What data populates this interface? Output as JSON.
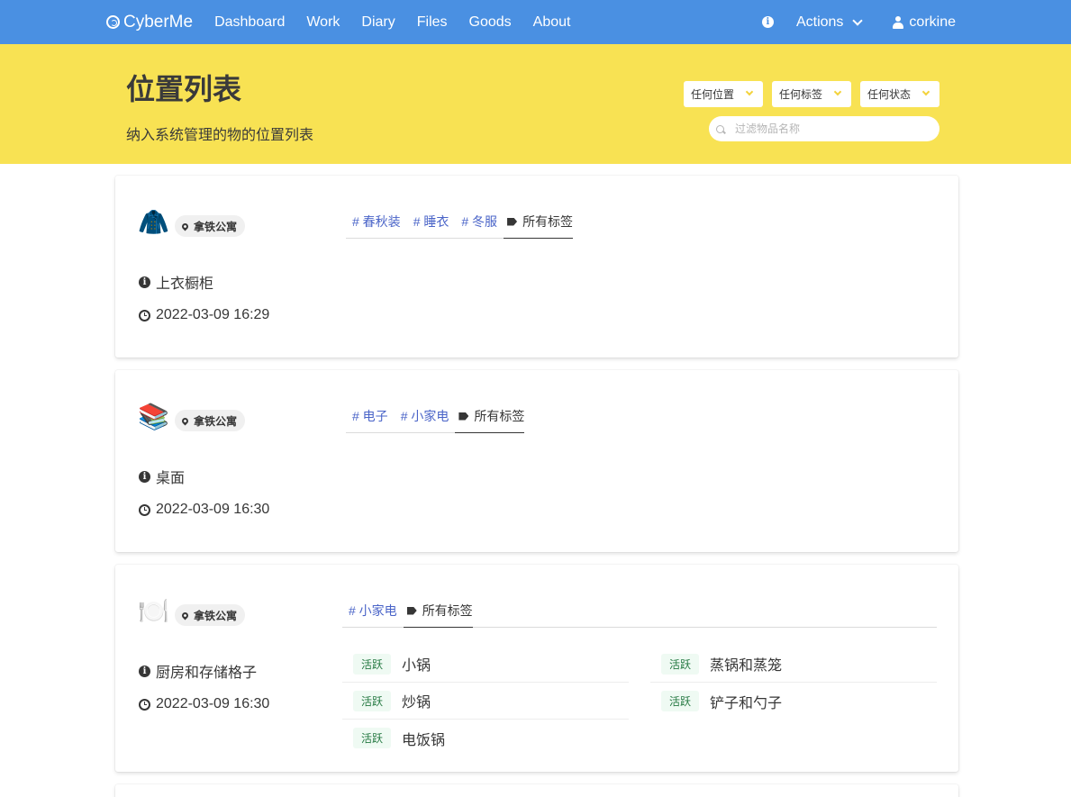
{
  "nav": {
    "brand": "CyberMe",
    "items": [
      "Dashboard",
      "Work",
      "Diary",
      "Files",
      "Goods",
      "About"
    ],
    "actions": "Actions",
    "user": "corkine"
  },
  "hero": {
    "title": "位置列表",
    "subtitle": "纳入系统管理的物的位置列表",
    "filters": [
      "任何位置",
      "任何标签",
      "任何状态"
    ],
    "search_placeholder": "过滤物品名称"
  },
  "cards": [
    {
      "emoji": "🧥",
      "location_tag": "拿铁公寓",
      "tags": [
        "# 春秋装",
        "# 睡衣",
        "# 冬服"
      ],
      "all_tags_label": "所有标签",
      "name": "上衣橱柜",
      "time": "2022-03-09 16:29",
      "goods": []
    },
    {
      "emoji": "📚",
      "location_tag": "拿铁公寓",
      "tags": [
        "# 电子",
        "# 小家电"
      ],
      "all_tags_label": "所有标签",
      "name": "桌面",
      "time": "2022-03-09 16:30",
      "goods": []
    },
    {
      "emoji": "🍽️",
      "location_tag": "拿铁公寓",
      "tags": [
        "# 小家电"
      ],
      "all_tags_label": "所有标签",
      "name": "厨房和存储格子",
      "time": "2022-03-09 16:30",
      "goods": [
        {
          "status": "活跃",
          "name": "小锅"
        },
        {
          "status": "活跃",
          "name": "炒锅"
        },
        {
          "status": "活跃",
          "name": "电饭锅"
        },
        {
          "status": "活跃",
          "name": "蒸锅和蒸笼"
        },
        {
          "status": "活跃",
          "name": "铲子和勺子"
        }
      ]
    }
  ],
  "colors": {
    "navbar": "#4a90e2",
    "hero": "#f8e253",
    "tag_link": "#4a64c8",
    "badge_bg": "#effaf3",
    "badge_text": "#257942"
  }
}
